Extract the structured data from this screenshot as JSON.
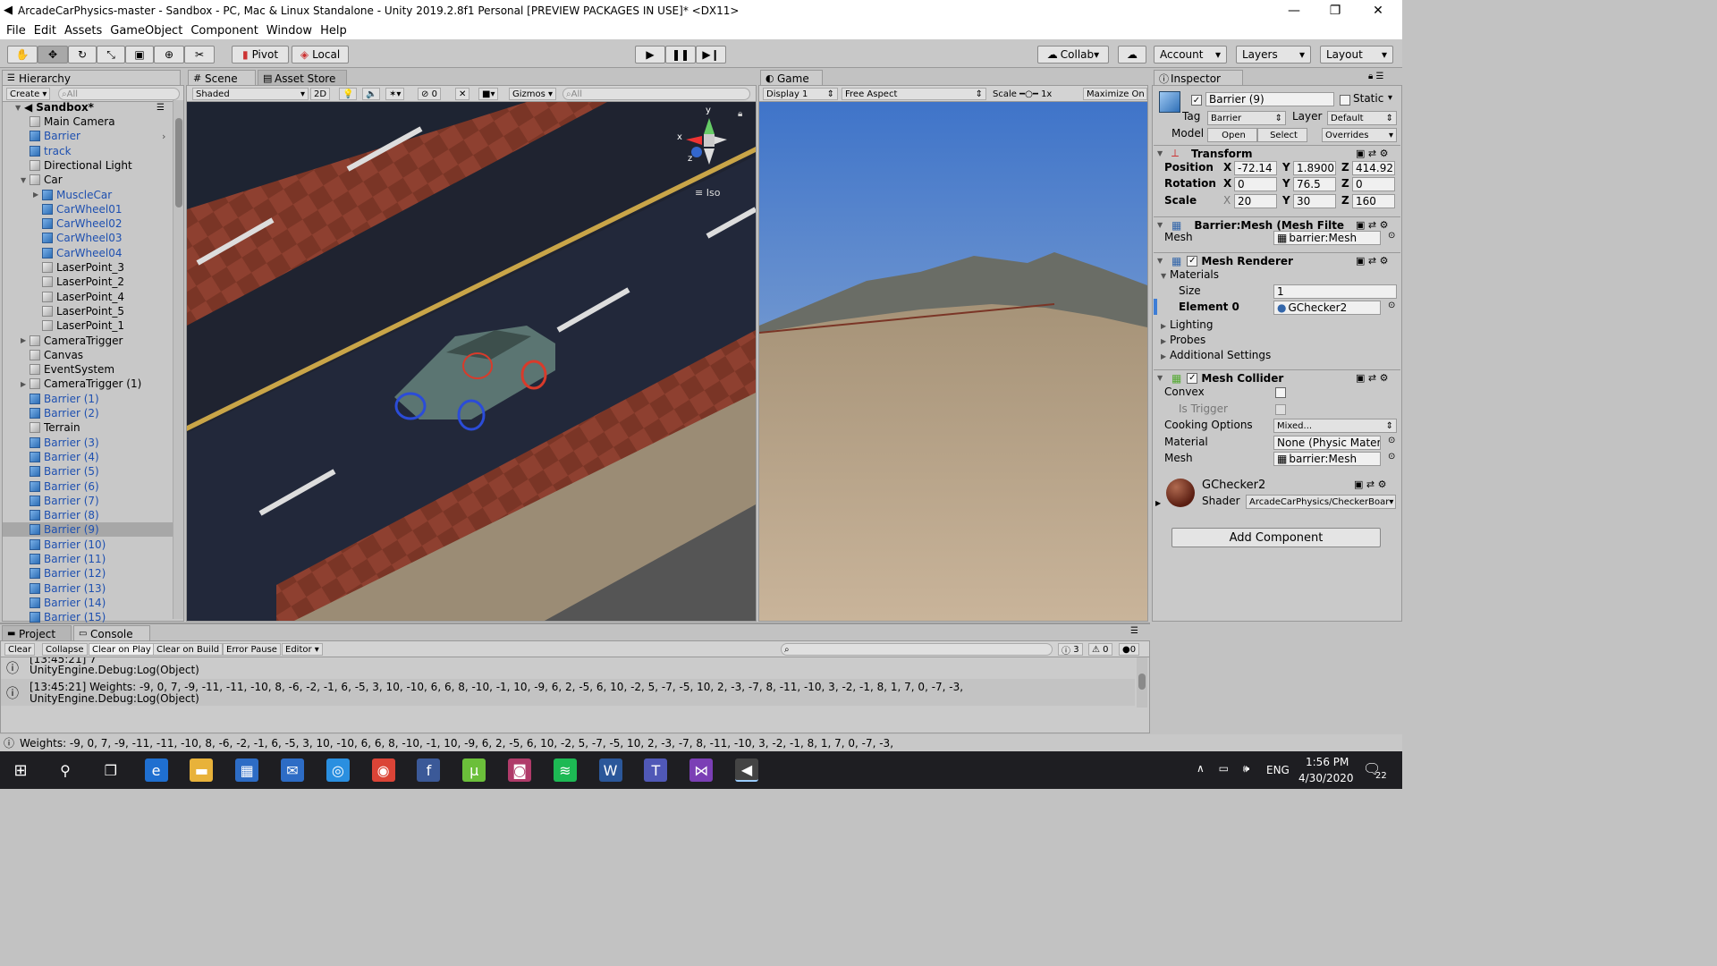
{
  "window": {
    "title": "ArcadeCarPhysics-master - Sandbox - PC, Mac & Linux Standalone - Unity 2019.2.8f1 Personal [PREVIEW PACKAGES IN USE]* <DX11>"
  },
  "menu": [
    "File",
    "Edit",
    "Assets",
    "GameObject",
    "Component",
    "Window",
    "Help"
  ],
  "toolbar": {
    "pivot": "Pivot",
    "local": "Local",
    "collab": "Collab",
    "account": "Account",
    "layers": "Layers",
    "layout": "Layout"
  },
  "hierarchy": {
    "tab": "Hierarchy",
    "create": "Create",
    "search_placeholder": "All",
    "root": "Sandbox*",
    "items": [
      {
        "label": "Main Camera",
        "indent": 1,
        "kind": "g"
      },
      {
        "label": "Barrier",
        "indent": 1,
        "kind": "b",
        "blue": true,
        "arrowRight": true
      },
      {
        "label": "track",
        "indent": 1,
        "kind": "b",
        "blue": true
      },
      {
        "label": "Directional Light",
        "indent": 1,
        "kind": "g"
      },
      {
        "label": "Car",
        "indent": 1,
        "kind": "g",
        "expand": "open"
      },
      {
        "label": "MuscleCar",
        "indent": 2,
        "kind": "b",
        "blue": true,
        "expand": "closed"
      },
      {
        "label": "CarWheel01",
        "indent": 2,
        "kind": "b",
        "blue": true
      },
      {
        "label": "CarWheel02",
        "indent": 2,
        "kind": "b",
        "blue": true
      },
      {
        "label": "CarWheel03",
        "indent": 2,
        "kind": "b",
        "blue": true
      },
      {
        "label": "CarWheel04",
        "indent": 2,
        "kind": "b",
        "blue": true
      },
      {
        "label": "LaserPoint_3",
        "indent": 2,
        "kind": "g"
      },
      {
        "label": "LaserPoint_2",
        "indent": 2,
        "kind": "g"
      },
      {
        "label": "LaserPoint_4",
        "indent": 2,
        "kind": "g"
      },
      {
        "label": "LaserPoint_5",
        "indent": 2,
        "kind": "g"
      },
      {
        "label": "LaserPoint_1",
        "indent": 2,
        "kind": "g"
      },
      {
        "label": "CameraTrigger",
        "indent": 1,
        "kind": "g",
        "expand": "closed"
      },
      {
        "label": "Canvas",
        "indent": 1,
        "kind": "g"
      },
      {
        "label": "EventSystem",
        "indent": 1,
        "kind": "g"
      },
      {
        "label": "CameraTrigger (1)",
        "indent": 1,
        "kind": "g",
        "expand": "closed"
      },
      {
        "label": "Barrier (1)",
        "indent": 1,
        "kind": "b",
        "blue": true
      },
      {
        "label": "Barrier (2)",
        "indent": 1,
        "kind": "b",
        "blue": true
      },
      {
        "label": "Terrain",
        "indent": 1,
        "kind": "g"
      },
      {
        "label": "Barrier (3)",
        "indent": 1,
        "kind": "b",
        "blue": true
      },
      {
        "label": "Barrier (4)",
        "indent": 1,
        "kind": "b",
        "blue": true
      },
      {
        "label": "Barrier (5)",
        "indent": 1,
        "kind": "b",
        "blue": true
      },
      {
        "label": "Barrier (6)",
        "indent": 1,
        "kind": "b",
        "blue": true
      },
      {
        "label": "Barrier (7)",
        "indent": 1,
        "kind": "b",
        "blue": true
      },
      {
        "label": "Barrier (8)",
        "indent": 1,
        "kind": "b",
        "blue": true
      },
      {
        "label": "Barrier (9)",
        "indent": 1,
        "kind": "b",
        "blue": true,
        "selected": true
      },
      {
        "label": "Barrier (10)",
        "indent": 1,
        "kind": "b",
        "blue": true
      },
      {
        "label": "Barrier (11)",
        "indent": 1,
        "kind": "b",
        "blue": true
      },
      {
        "label": "Barrier (12)",
        "indent": 1,
        "kind": "b",
        "blue": true
      },
      {
        "label": "Barrier (13)",
        "indent": 1,
        "kind": "b",
        "blue": true
      },
      {
        "label": "Barrier (14)",
        "indent": 1,
        "kind": "b",
        "blue": true
      },
      {
        "label": "Barrier (15)",
        "indent": 1,
        "kind": "b",
        "blue": true
      }
    ]
  },
  "scene": {
    "tab": "Scene",
    "asset_store": "Asset Store",
    "shading": "Shaded",
    "mode2d": "2D",
    "gizmos": "Gizmos",
    "search_placeholder": "All",
    "iso": "Iso",
    "hidden_count": "0",
    "axis": {
      "x": "x",
      "y": "y",
      "z": "z"
    }
  },
  "game": {
    "tab": "Game",
    "display": "Display 1",
    "aspect": "Free Aspect",
    "scale_label": "Scale",
    "scale_value": "1x",
    "maximize": "Maximize On"
  },
  "inspector": {
    "tab": "Inspector",
    "name": "Barrier (9)",
    "static": "Static",
    "tag_label": "Tag",
    "tag": "Barrier",
    "layer_label": "Layer",
    "layer": "Default",
    "model_label": "Model",
    "open": "Open",
    "select": "Select",
    "overrides": "Overrides",
    "transform": {
      "title": "Transform",
      "position_label": "Position",
      "rotation_label": "Rotation",
      "scale_label": "Scale",
      "position": [
        "-72.14",
        "1.8900",
        "414.92"
      ],
      "rotation": [
        "0",
        "76.5",
        "0"
      ],
      "scale": [
        "20",
        "30",
        "160"
      ],
      "axes": [
        "X",
        "Y",
        "Z"
      ]
    },
    "mesh_filter": {
      "title": "Barrier:Mesh (Mesh Filte",
      "mesh_label": "Mesh",
      "mesh": "barrier:Mesh"
    },
    "mesh_renderer": {
      "title": "Mesh Renderer",
      "materials": "Materials",
      "size_label": "Size",
      "size": "1",
      "element_label": "Element 0",
      "element": "GChecker2",
      "lighting": "Lighting",
      "probes": "Probes",
      "additional": "Additional Settings"
    },
    "mesh_collider": {
      "title": "Mesh Collider",
      "convex": "Convex",
      "is_trigger": "Is Trigger",
      "cooking_label": "Cooking Options",
      "cooking": "Mixed...",
      "material_label": "Material",
      "material": "None (Physic Materia",
      "mesh_label": "Mesh",
      "mesh": "barrier:Mesh"
    },
    "material": {
      "name": "GChecker2",
      "shader_label": "Shader",
      "shader": "ArcadeCarPhysics/CheckerBoar"
    },
    "add_component": "Add Component"
  },
  "bottom": {
    "project_tab": "Project",
    "console_tab": "Console",
    "buttons": [
      "Clear",
      "Collapse",
      "Clear on Play",
      "Clear on Build",
      "Error Pause",
      "Editor"
    ],
    "count_log": "3",
    "count_warn": "0",
    "count_err": "0",
    "logs": [
      {
        "l1": "[13:45:21] 7",
        "l2": "UnityEngine.Debug:Log(Object)"
      },
      {
        "l1": "[13:45:21] Weights: -9, 0, 7, -9, -11, -11, -10, 8, -6, -2, -1, 6, -5, 3, 10, -10, 6, 6, 8, -10, -1, 10, -9, 6, 2, -5, 6, 10, -2, 5, -7, -5, 10, 2, -3, -7, 8, -11, -10, 3, -2, -1, 8, 1, 7, 0, -7, -3,",
        "l2": "UnityEngine.Debug:Log(Object)"
      }
    ],
    "status": "Weights: -9, 0, 7, -9, -11, -11, -10, 8, -6, -2, -1, 6, -5, 3, 10, -10, 6, 6, 8, -10, -1, 10, -9, 6, 2, -5, 6, 10, -2, 5, -7, -5, 10, 2, -3, -7, 8, -11, -10, 3, -2, -1, 8, 1, 7, 0, -7, -3,"
  },
  "taskbar": {
    "time": "1:56 PM",
    "date": "4/30/2020",
    "lang": "ENG",
    "notif": "22",
    "apps": [
      "search-icon",
      "task-view-icon",
      "edge-icon",
      "file-explorer-icon",
      "store-icon",
      "mail-icon",
      "safari-icon",
      "chrome-icon",
      "facebook-icon",
      "utorrent-icon",
      "camera-app-icon",
      "spotify-icon",
      "word-icon",
      "teams-icon",
      "visual-studio-icon",
      "unity-icon"
    ]
  }
}
